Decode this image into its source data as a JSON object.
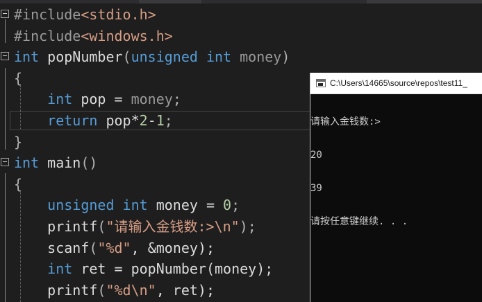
{
  "editor": {
    "lines": [
      {
        "segments": [
          {
            "t": "#include",
            "c": "pp"
          },
          {
            "t": "<stdio.h>",
            "c": "inc"
          }
        ]
      },
      {
        "segments": [
          {
            "t": "#include",
            "c": "pp"
          },
          {
            "t": "<windows.h>",
            "c": "inc"
          }
        ]
      },
      {
        "segments": [
          {
            "t": "int",
            "c": "kw"
          },
          {
            "t": " popNumber",
            "c": ""
          },
          {
            "t": "(",
            "c": "punct"
          },
          {
            "t": "unsigned",
            "c": "kw"
          },
          {
            "t": " ",
            "c": ""
          },
          {
            "t": "int",
            "c": "kw"
          },
          {
            "t": " money",
            "c": "par"
          },
          {
            "t": ")",
            "c": "punct"
          }
        ]
      },
      {
        "segments": [
          {
            "t": "{",
            "c": "punct"
          }
        ]
      },
      {
        "segments": [
          {
            "t": "    ",
            "c": ""
          },
          {
            "t": "int",
            "c": "kw"
          },
          {
            "t": " pop = ",
            "c": ""
          },
          {
            "t": "money",
            "c": "par"
          },
          {
            "t": ";",
            "c": "punct"
          }
        ]
      },
      {
        "segments": [
          {
            "t": "    ",
            "c": ""
          },
          {
            "t": "return",
            "c": "kw"
          },
          {
            "t": " pop*",
            "c": ""
          },
          {
            "t": "2",
            "c": "num"
          },
          {
            "t": "-",
            "c": ""
          },
          {
            "t": "1",
            "c": "num"
          },
          {
            "t": ";",
            "c": "punct"
          }
        ]
      },
      {
        "segments": [
          {
            "t": "}",
            "c": "punct"
          }
        ]
      },
      {
        "segments": [
          {
            "t": "int",
            "c": "kw"
          },
          {
            "t": " main",
            "c": ""
          },
          {
            "t": "()",
            "c": "punct"
          }
        ]
      },
      {
        "segments": [
          {
            "t": "{",
            "c": "punct"
          }
        ]
      },
      {
        "segments": [
          {
            "t": "    ",
            "c": ""
          },
          {
            "t": "unsigned",
            "c": "kw"
          },
          {
            "t": " ",
            "c": ""
          },
          {
            "t": "int",
            "c": "kw"
          },
          {
            "t": " money = ",
            "c": ""
          },
          {
            "t": "0",
            "c": "num"
          },
          {
            "t": ";",
            "c": "punct"
          }
        ]
      },
      {
        "segments": [
          {
            "t": "    ",
            "c": ""
          },
          {
            "t": "printf",
            "c": ""
          },
          {
            "t": "(",
            "c": "punct"
          },
          {
            "t": "\"请输入金钱数:>\\n\"",
            "c": "str"
          },
          {
            "t": ");",
            "c": "punct"
          }
        ]
      },
      {
        "segments": [
          {
            "t": "    ",
            "c": ""
          },
          {
            "t": "scanf",
            "c": ""
          },
          {
            "t": "(",
            "c": "punct"
          },
          {
            "t": "\"%d\"",
            "c": "str"
          },
          {
            "t": ", &money);",
            "c": ""
          }
        ]
      },
      {
        "segments": [
          {
            "t": "    ",
            "c": ""
          },
          {
            "t": "int",
            "c": "kw"
          },
          {
            "t": " ret = popNumber(money);",
            "c": ""
          }
        ]
      },
      {
        "segments": [
          {
            "t": "    ",
            "c": ""
          },
          {
            "t": "printf",
            "c": ""
          },
          {
            "t": "(",
            "c": "punct"
          },
          {
            "t": "\"%d\\n\"",
            "c": "str"
          },
          {
            "t": ", ret);",
            "c": ""
          }
        ]
      }
    ]
  },
  "console": {
    "title": "C:\\Users\\14665\\source\\repos\\test11_",
    "output": [
      "请输入金钱数:>",
      "20",
      "39",
      "请按任意键继续. . ."
    ]
  }
}
